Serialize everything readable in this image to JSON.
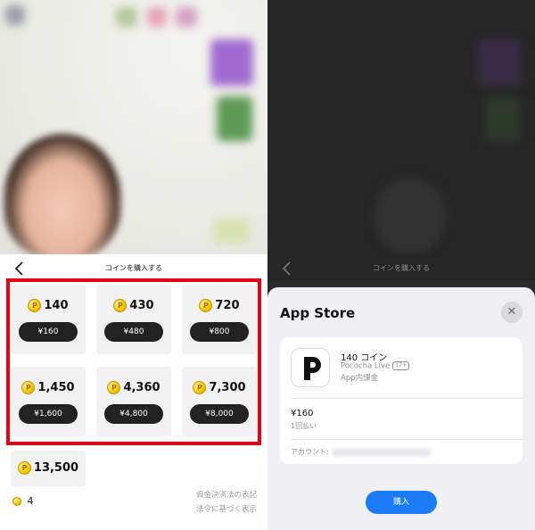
{
  "left": {
    "header_title": "コインを購入する",
    "back_icon": "chevron-left-icon",
    "packages": [
      {
        "coins": "140",
        "price": "¥160"
      },
      {
        "coins": "430",
        "price": "¥480"
      },
      {
        "coins": "720",
        "price": "¥800"
      },
      {
        "coins": "1,450",
        "price": "¥1,600"
      },
      {
        "coins": "4,360",
        "price": "¥4,800"
      },
      {
        "coins": "7,300",
        "price": "¥8,000"
      },
      {
        "coins": "13,500",
        "price": ""
      }
    ],
    "balance": "4",
    "legal_1": "資金決済法の表記",
    "legal_2": "法令に基づく表示",
    "highlight_color": "#e60012"
  },
  "right": {
    "header_title": "コインを購入する",
    "sheet_title": "App Store",
    "close_icon": "close-icon",
    "item_name": "140 コイン",
    "app_name": "Pococha Live",
    "age_badge": "17+",
    "purchase_type": "App内課金",
    "price": "¥160",
    "price_note": "1回払い",
    "account_label": "アカウント:",
    "buy_label": "購入",
    "accent_color": "#1a7cf7"
  }
}
